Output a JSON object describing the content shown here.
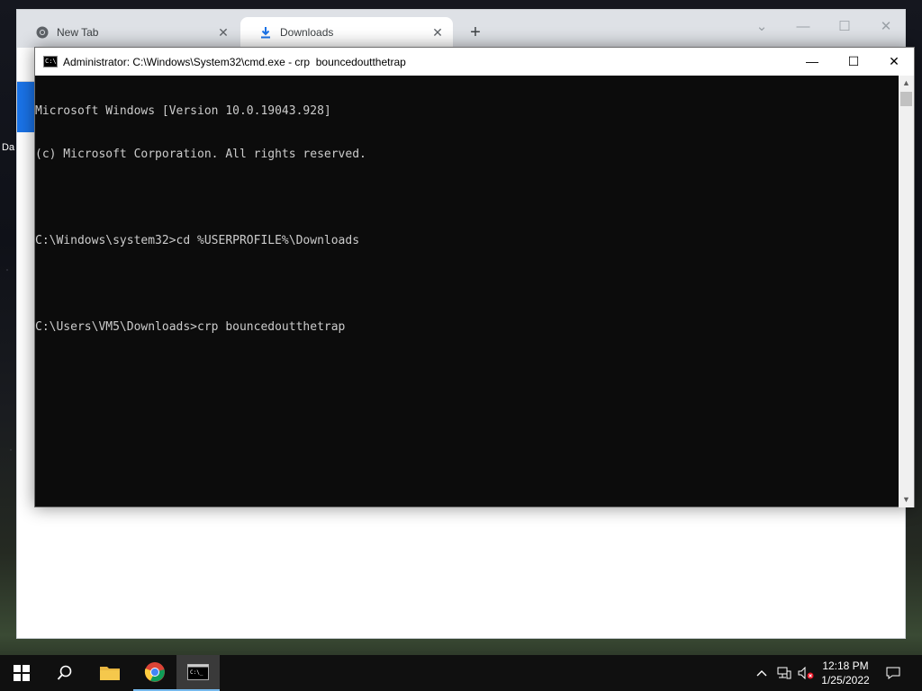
{
  "desktop": {
    "icon_label_fragment": "Da"
  },
  "browser": {
    "tabs": [
      {
        "label": "New Tab",
        "icon": "chrome-icon"
      },
      {
        "label": "Downloads",
        "icon": "download-icon"
      }
    ],
    "new_tab_symbol": "+",
    "controls": {
      "dropdown": "⌄",
      "minimize": "—",
      "maximize": "☐",
      "close": "✕"
    }
  },
  "cmd": {
    "title": "Administrator: C:\\Windows\\System32\\cmd.exe - crp  bouncedoutthetrap",
    "controls": {
      "minimize": "—",
      "maximize": "☐",
      "close": "✕"
    },
    "lines": [
      "Microsoft Windows [Version 10.0.19043.928]",
      "(c) Microsoft Corporation. All rights reserved.",
      "",
      "C:\\Windows\\system32>cd %USERPROFILE%\\Downloads",
      "",
      "C:\\Users\\VM5\\Downloads>crp bouncedoutthetrap"
    ]
  },
  "taskbar": {
    "apps": [
      "windows-start",
      "search",
      "file-explorer",
      "chrome",
      "command-prompt"
    ],
    "time": "12:18 PM",
    "date": "1/25/2022"
  },
  "colors": {
    "accent": "#1a73e8",
    "terminal_bg": "#0c0c0c",
    "terminal_fg": "#cccccc",
    "taskbar_bg": "#101010"
  }
}
